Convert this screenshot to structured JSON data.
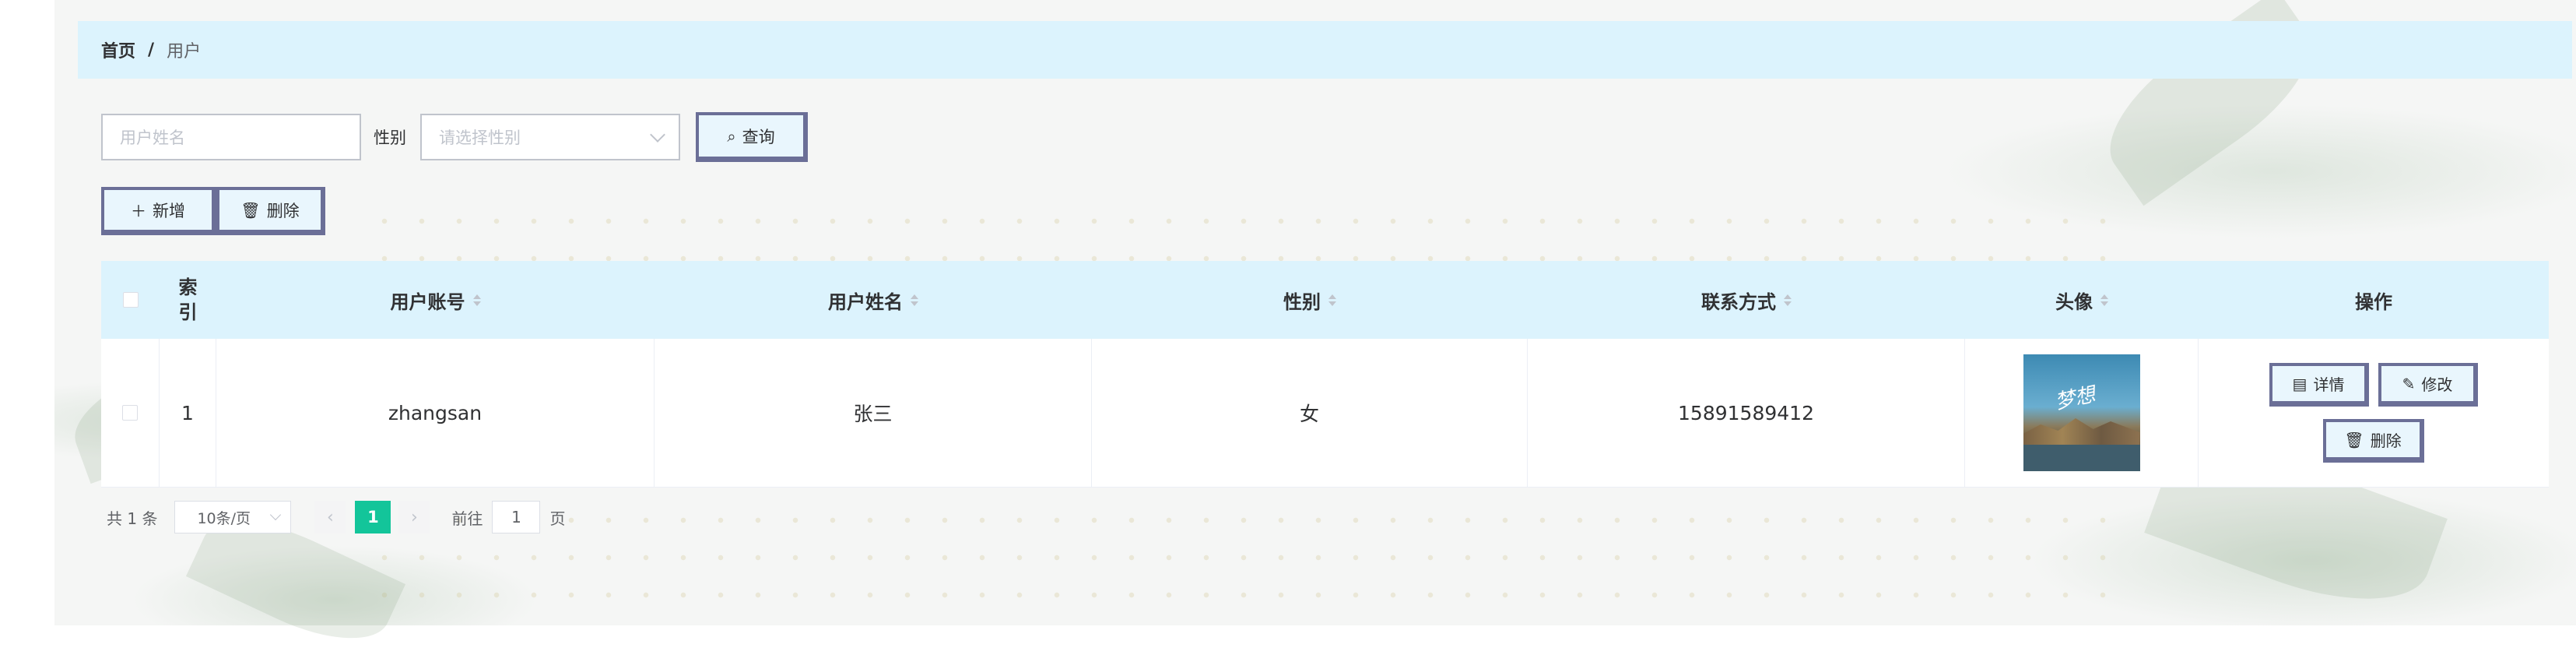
{
  "breadcrumb": {
    "home": "首页",
    "separator": "/",
    "current": "用户"
  },
  "search": {
    "name_placeholder": "用户姓名",
    "gender_label": "性别",
    "gender_placeholder": "请选择性别",
    "query_label": "查询",
    "query_icon": "search-icon"
  },
  "toolbar": {
    "add_label": "新增",
    "add_icon": "plus-icon",
    "delete_label": "删除",
    "delete_icon": "trash-icon"
  },
  "table": {
    "columns": {
      "index": "索引",
      "account": "用户账号",
      "name": "用户姓名",
      "gender": "性别",
      "contact": "联系方式",
      "avatar": "头像",
      "actions": "操作"
    },
    "rows": [
      {
        "index": "1",
        "account": "zhangsan",
        "name": "张三",
        "gender": "女",
        "contact": "15891589412",
        "avatar_text": "梦想",
        "actions": {
          "detail": "详情",
          "edit": "修改",
          "delete": "删除"
        }
      }
    ]
  },
  "pagination": {
    "total": "共 1 条",
    "page_size": "10条/页",
    "prev": "‹",
    "current_page": "1",
    "next": "›",
    "goto_prefix": "前往",
    "goto_value": "1",
    "goto_suffix": "页"
  },
  "colors": {
    "header_bg": "#dcf3fd",
    "button_border": "#6b6f97",
    "page_active": "#13c59a"
  }
}
